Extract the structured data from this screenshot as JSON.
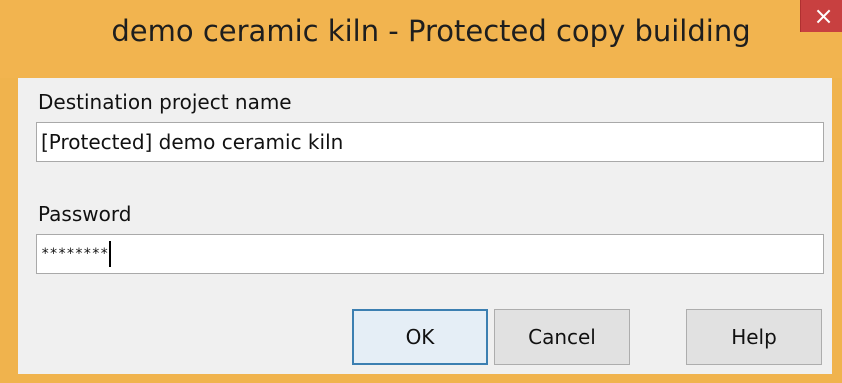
{
  "window": {
    "title": "demo ceramic kiln - Protected copy building",
    "close_glyph": "×"
  },
  "form": {
    "destination_label": "Destination project name",
    "destination_value": "[Protected] demo ceramic kiln",
    "password_label": "Password",
    "password_value": "********"
  },
  "buttons": {
    "ok_label": "OK",
    "cancel_label": "Cancel",
    "help_label": "Help"
  },
  "colors": {
    "title_bar": "#f2b44f",
    "close_button": "#c84040",
    "dialog_background": "#f0f0f0",
    "default_button_border": "#3c7fb1"
  },
  "icons": {
    "close": "close-icon"
  }
}
